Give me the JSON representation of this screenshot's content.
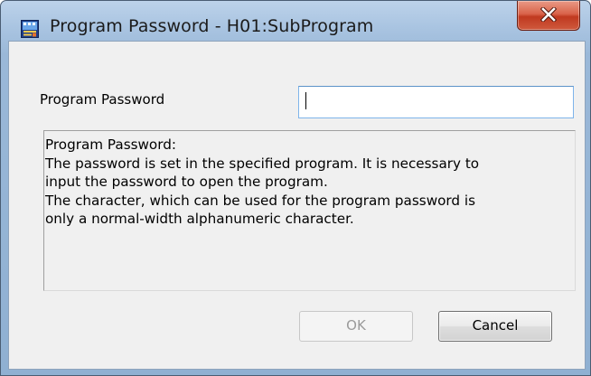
{
  "window": {
    "title": "Program Password - H01:SubProgram",
    "icon": "program-app-icon",
    "close_icon": "close-x-icon",
    "accent": "#c0391f"
  },
  "form": {
    "password_label": "Program Password",
    "password_value": "",
    "password_placeholder": ""
  },
  "description": {
    "lines": [
      "Program Password:",
      "The password is set in the specified program. It is necessary to",
      "input the password to open the program.",
      "The character, which can be used for the program password is",
      "only a normal-width alphanumeric character."
    ]
  },
  "buttons": {
    "ok_label": "OK",
    "ok_enabled": false,
    "cancel_label": "Cancel"
  }
}
